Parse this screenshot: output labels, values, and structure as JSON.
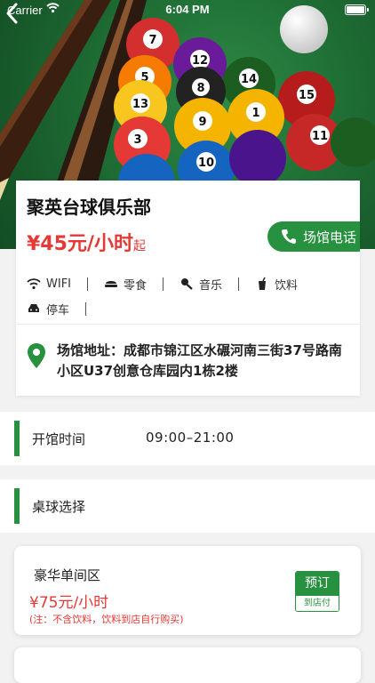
{
  "status_bar": {
    "carrier": "Carrier",
    "time": "6:04 PM"
  },
  "venue": {
    "name": "聚英台球俱乐部",
    "price": "¥45元/小时",
    "price_suffix": "起",
    "phone_button": "场馆电话",
    "amenities": [
      {
        "icon": "wifi-icon",
        "label": "WIFI"
      },
      {
        "icon": "snack-icon",
        "label": "零食"
      },
      {
        "icon": "music-icon",
        "label": "音乐"
      },
      {
        "icon": "drink-icon",
        "label": "饮料"
      },
      {
        "icon": "car-icon",
        "label": "停车"
      }
    ],
    "address": "场馆地址：成都市锦江区水碾河南三街37号路南小区U37创意仓库园内1栋2楼"
  },
  "opening": {
    "label": "开馆时间",
    "value": "09:00–21:00"
  },
  "table_select": {
    "label": "桌球选择"
  },
  "tables": [
    {
      "name": "豪华单间区",
      "price": "¥75元/小时",
      "note": "(注：不含饮料，饮料到店自行购买)",
      "book_label": "预订",
      "book_sub": "到店付"
    }
  ],
  "colors": {
    "accent": "#27913f",
    "price": "#e53935",
    "background": "#f2f2f2"
  }
}
